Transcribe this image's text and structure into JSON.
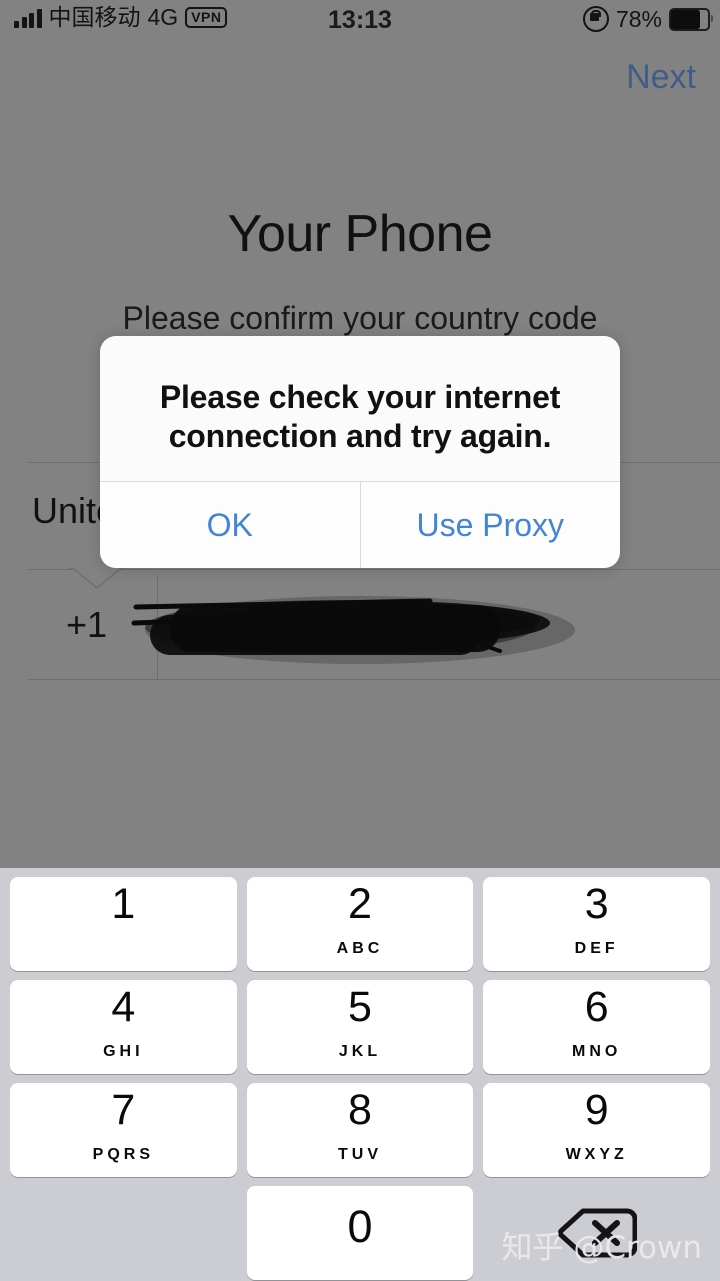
{
  "status_bar": {
    "carrier": "中国移动",
    "network": "4G",
    "vpn_badge": "VPN",
    "time": "13:13",
    "battery_percent": "78%",
    "battery_level": 78,
    "signal_bars": 4,
    "rotation_lock_icon": "rotation-lock-icon",
    "battery_icon": "battery-icon"
  },
  "nav": {
    "next_label": "Next"
  },
  "page": {
    "title": "Your Phone",
    "subtitle": "Please confirm your country code"
  },
  "form": {
    "country_label": "United States",
    "country_label_visible": "Unit",
    "country_code": "+1",
    "phone_value": "",
    "phone_placeholder": "",
    "chevron_icon": "chevron-down-icon",
    "redaction_icon": "redaction-scribble"
  },
  "alert": {
    "message": "Please check your internet connection and try again.",
    "buttons": [
      {
        "label": "OK",
        "name": "ok-button"
      },
      {
        "label": "Use Proxy",
        "name": "use-proxy-button"
      }
    ]
  },
  "keypad": {
    "rows": [
      [
        {
          "digit": "1",
          "letters": ""
        },
        {
          "digit": "2",
          "letters": "ABC"
        },
        {
          "digit": "3",
          "letters": "DEF"
        }
      ],
      [
        {
          "digit": "4",
          "letters": "GHI"
        },
        {
          "digit": "5",
          "letters": "JKL"
        },
        {
          "digit": "6",
          "letters": "MNO"
        }
      ],
      [
        {
          "digit": "7",
          "letters": "PQRS"
        },
        {
          "digit": "8",
          "letters": "TUV"
        },
        {
          "digit": "9",
          "letters": "WXYZ"
        }
      ],
      [
        {
          "digit": "0",
          "letters": ""
        }
      ]
    ],
    "delete_icon": "delete-backspace-icon"
  },
  "watermark": {
    "text": "知乎 @Crown"
  },
  "colors": {
    "dim_overlay": "#828282",
    "keyboard_bg": "#cccdd2",
    "key_bg": "#ffffff",
    "alert_bg": "#fbfbfb",
    "accent_blue": "#4284d6",
    "next_blue_dimmed": "#3f5d86"
  }
}
